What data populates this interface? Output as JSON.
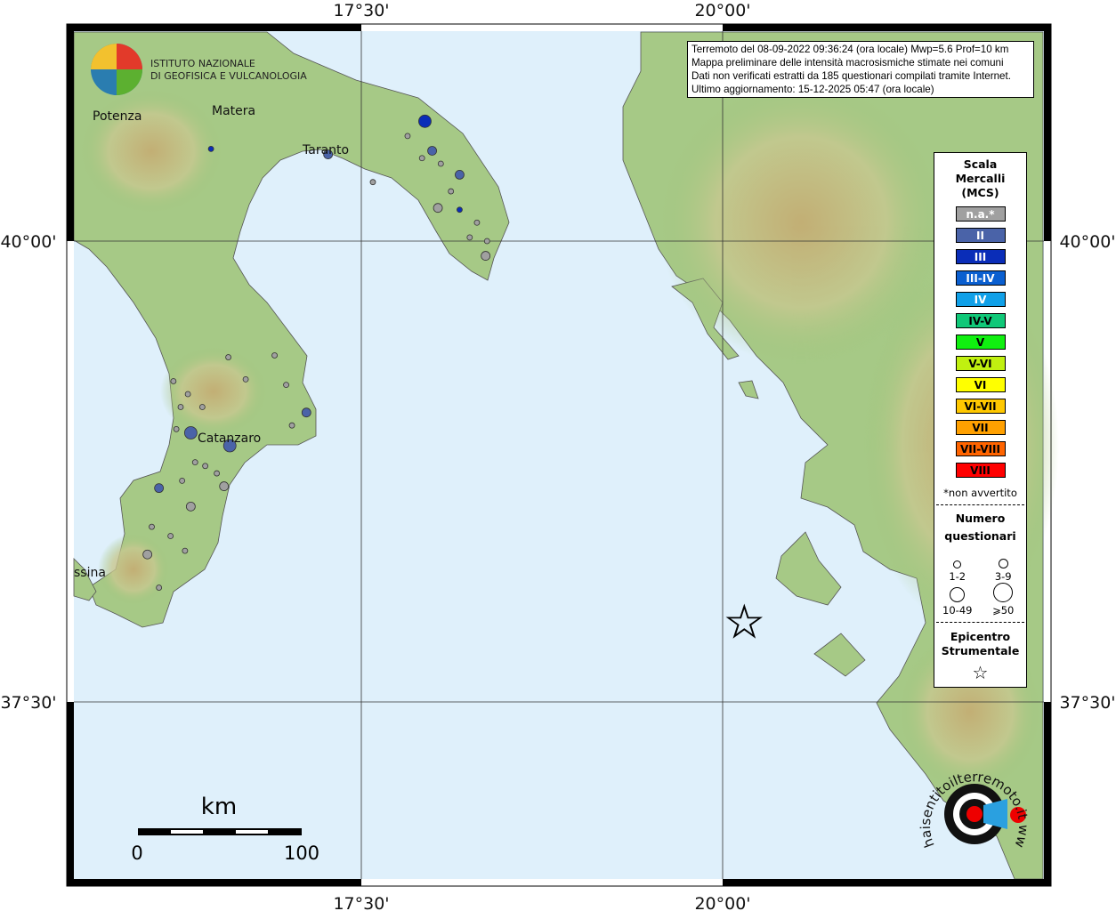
{
  "info": {
    "line1": "Terremoto del 08-09-2022 09:36:24 (ora locale) Mwp=5.6 Prof=10 km",
    "line2": "Mappa preliminare delle intensità macrosismiche stimate nei comuni",
    "line3": "Dati non verificati estratti da 185 questionari compilati tramite Internet.",
    "line4": "Ultimo aggiornamento: 15-12-2025 05:47 (ora locale)"
  },
  "logo": {
    "line1": "ISTITUTO NAZIONALE",
    "line2": "DI GEOFISICA E VULCANOLOGIA"
  },
  "watermark": "haisentitoilterremoto.it  www.",
  "axes": {
    "lon_labels": [
      "17°30'",
      "20°00'"
    ],
    "lat_labels": [
      "40°00'",
      "37°30'"
    ]
  },
  "places": [
    "Potenza",
    "Matera",
    "Taranto",
    "Catanzaro",
    "ssina"
  ],
  "scale": {
    "unit": "km",
    "min": "0",
    "max": "100"
  },
  "legend": {
    "title1": "Scala",
    "title2": "Mercalli",
    "title3": "(MCS)",
    "classes": [
      {
        "label": "n.a.*",
        "color": "#a0a0a0"
      },
      {
        "label": "II",
        "color": "#4a63a8"
      },
      {
        "label": "III",
        "color": "#0a2db8"
      },
      {
        "label": "III-IV",
        "color": "#0a5fd0"
      },
      {
        "label": "IV",
        "color": "#10a0e8"
      },
      {
        "label": "IV-V",
        "color": "#10c878"
      },
      {
        "label": "V",
        "color": "#10f010"
      },
      {
        "label": "V-VI",
        "color": "#c0f010"
      },
      {
        "label": "VI",
        "color": "#ffff00"
      },
      {
        "label": "VI-VII",
        "color": "#ffc800"
      },
      {
        "label": "VII",
        "color": "#ffa000"
      },
      {
        "label": "VII-VIII",
        "color": "#ff6400"
      },
      {
        "label": "VIII",
        "color": "#ff0000"
      }
    ],
    "na_note": "*non avvertito",
    "count_title1": "Numero",
    "count_title2": "questionari",
    "counts": [
      "1-2",
      "3-9",
      "10-49",
      "⩾50"
    ],
    "epi_title1": "Epicentro",
    "epi_title2": "Strumentale",
    "epi_symbol": "☆"
  },
  "epicenter": {
    "lon": 20.15,
    "lat": 37.93
  },
  "markers": [
    {
      "lon": 17.94,
      "lat": 40.65,
      "mcs": "III",
      "n": "10-49"
    },
    {
      "lon": 17.99,
      "lat": 40.49,
      "mcs": "II",
      "n": "3-9"
    },
    {
      "lon": 18.18,
      "lat": 40.36,
      "mcs": "II",
      "n": "3-9"
    },
    {
      "lon": 18.18,
      "lat": 40.17,
      "mcs": "III",
      "n": "1-2"
    },
    {
      "lon": 18.03,
      "lat": 40.18,
      "mcs": "n.a.*",
      "n": "3-9"
    },
    {
      "lon": 18.36,
      "lat": 39.92,
      "mcs": "n.a.*",
      "n": "3-9"
    },
    {
      "lon": 17.27,
      "lat": 40.47,
      "mcs": "II",
      "n": "3-9"
    },
    {
      "lon": 16.46,
      "lat": 40.5,
      "mcs": "III",
      "n": "1-2"
    },
    {
      "lon": 16.32,
      "lat": 38.96,
      "mcs": "II",
      "n": "10-49"
    },
    {
      "lon": 16.59,
      "lat": 38.89,
      "mcs": "II",
      "n": "10-49"
    },
    {
      "lon": 17.12,
      "lat": 39.07,
      "mcs": "II",
      "n": "3-9"
    },
    {
      "lon": 16.1,
      "lat": 38.66,
      "mcs": "II",
      "n": "3-9"
    },
    {
      "lon": 16.55,
      "lat": 38.67,
      "mcs": "n.a.*",
      "n": "3-9"
    },
    {
      "lon": 16.32,
      "lat": 38.56,
      "mcs": "n.a.*",
      "n": "3-9"
    },
    {
      "lon": 16.02,
      "lat": 38.3,
      "mcs": "n.a.*",
      "n": "3-9"
    },
    {
      "lon": 17.82,
      "lat": 40.57,
      "mcs": "n.a.*",
      "n": "1-2"
    },
    {
      "lon": 17.92,
      "lat": 40.45,
      "mcs": "n.a.*",
      "n": "1-2"
    },
    {
      "lon": 18.05,
      "lat": 40.42,
      "mcs": "n.a.*",
      "n": "1-2"
    },
    {
      "lon": 18.12,
      "lat": 40.27,
      "mcs": "n.a.*",
      "n": "1-2"
    },
    {
      "lon": 18.3,
      "lat": 40.1,
      "mcs": "n.a.*",
      "n": "1-2"
    },
    {
      "lon": 18.25,
      "lat": 40.02,
      "mcs": "n.a.*",
      "n": "1-2"
    },
    {
      "lon": 18.37,
      "lat": 40.0,
      "mcs": "n.a.*",
      "n": "1-2"
    },
    {
      "lon": 17.58,
      "lat": 40.32,
      "mcs": "n.a.*",
      "n": "1-2"
    },
    {
      "lon": 16.2,
      "lat": 39.24,
      "mcs": "n.a.*",
      "n": "1-2"
    },
    {
      "lon": 16.3,
      "lat": 39.17,
      "mcs": "n.a.*",
      "n": "1-2"
    },
    {
      "lon": 16.25,
      "lat": 39.1,
      "mcs": "n.a.*",
      "n": "1-2"
    },
    {
      "lon": 16.4,
      "lat": 39.1,
      "mcs": "n.a.*",
      "n": "1-2"
    },
    {
      "lon": 16.22,
      "lat": 38.98,
      "mcs": "n.a.*",
      "n": "1-2"
    },
    {
      "lon": 16.35,
      "lat": 38.8,
      "mcs": "n.a.*",
      "n": "1-2"
    },
    {
      "lon": 16.42,
      "lat": 38.78,
      "mcs": "n.a.*",
      "n": "1-2"
    },
    {
      "lon": 16.5,
      "lat": 38.74,
      "mcs": "n.a.*",
      "n": "1-2"
    },
    {
      "lon": 16.26,
      "lat": 38.7,
      "mcs": "n.a.*",
      "n": "1-2"
    },
    {
      "lon": 16.05,
      "lat": 38.45,
      "mcs": "n.a.*",
      "n": "1-2"
    },
    {
      "lon": 16.18,
      "lat": 38.4,
      "mcs": "n.a.*",
      "n": "1-2"
    },
    {
      "lon": 16.28,
      "lat": 38.32,
      "mcs": "n.a.*",
      "n": "1-2"
    },
    {
      "lon": 16.1,
      "lat": 38.12,
      "mcs": "n.a.*",
      "n": "1-2"
    },
    {
      "lon": 16.98,
      "lat": 39.22,
      "mcs": "n.a.*",
      "n": "1-2"
    },
    {
      "lon": 17.02,
      "lat": 39.0,
      "mcs": "n.a.*",
      "n": "1-2"
    },
    {
      "lon": 16.9,
      "lat": 39.38,
      "mcs": "n.a.*",
      "n": "1-2"
    },
    {
      "lon": 16.7,
      "lat": 39.25,
      "mcs": "n.a.*",
      "n": "1-2"
    },
    {
      "lon": 16.58,
      "lat": 39.37,
      "mcs": "n.a.*",
      "n": "1-2"
    }
  ]
}
